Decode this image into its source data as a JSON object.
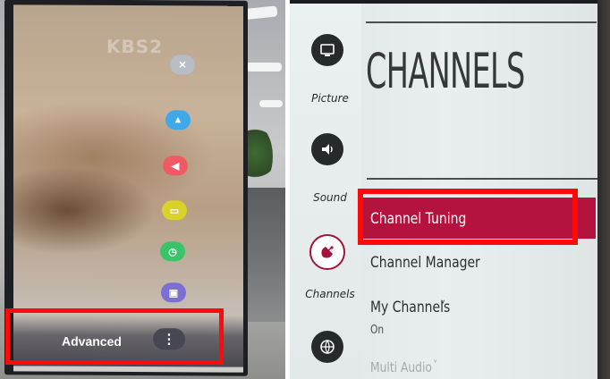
{
  "left_photo": {
    "channel_watermark": "KBS2",
    "quick_buttons": [
      {
        "icon": "close-icon",
        "glyph": "✕",
        "color": "#b8bcc4"
      },
      {
        "icon": "picture-icon",
        "glyph": "▲",
        "color": "#3ea8e8"
      },
      {
        "icon": "sound-icon",
        "glyph": "◀",
        "color": "#f05a64"
      },
      {
        "icon": "aspect-ratio-icon",
        "glyph": "▭",
        "color": "#d9d228"
      },
      {
        "icon": "timer-icon",
        "glyph": "◷",
        "color": "#39c46a"
      },
      {
        "icon": "lock-icon",
        "glyph": "▣",
        "color": "#7b6fd6"
      }
    ],
    "advanced_label": "Advanced",
    "more_glyph": "⋮",
    "highlight_color": "#ff0a0a"
  },
  "right_photo": {
    "title": "CHANNELS",
    "nav": [
      {
        "label": "Picture",
        "icon": "picture-settings-icon"
      },
      {
        "label": "Sound",
        "icon": "sound-settings-icon"
      },
      {
        "label": "Channels",
        "icon": "channels-satellite-icon",
        "active": true
      },
      {
        "label": "",
        "icon": "network-icon"
      }
    ],
    "menu": {
      "channel_tuning": "Channel Tuning",
      "channel_manager": "Channel Manager",
      "my_channels": "My Channels",
      "my_channels_value": "On",
      "multi_audio": "Multi Audio",
      "chevron": "˅"
    },
    "accent_color": "#b3133c",
    "highlight_color": "#ff0a0a"
  }
}
